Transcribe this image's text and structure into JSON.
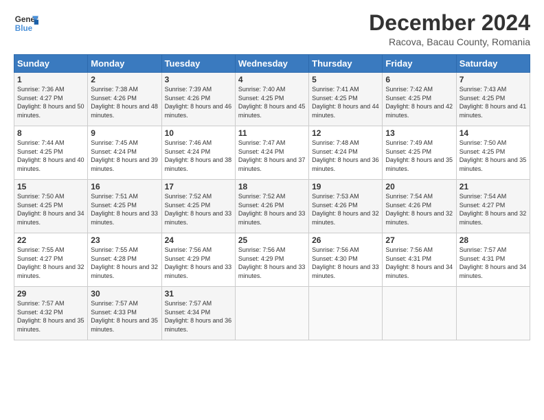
{
  "header": {
    "logo_line1": "General",
    "logo_line2": "Blue",
    "month_title": "December 2024",
    "location": "Racova, Bacau County, Romania"
  },
  "weekdays": [
    "Sunday",
    "Monday",
    "Tuesday",
    "Wednesday",
    "Thursday",
    "Friday",
    "Saturday"
  ],
  "weeks": [
    [
      {
        "day": "1",
        "sunrise": "7:36 AM",
        "sunset": "4:27 PM",
        "daylight": "8 hours and 50 minutes."
      },
      {
        "day": "2",
        "sunrise": "7:38 AM",
        "sunset": "4:26 PM",
        "daylight": "8 hours and 48 minutes."
      },
      {
        "day": "3",
        "sunrise": "7:39 AM",
        "sunset": "4:26 PM",
        "daylight": "8 hours and 46 minutes."
      },
      {
        "day": "4",
        "sunrise": "7:40 AM",
        "sunset": "4:25 PM",
        "daylight": "8 hours and 45 minutes."
      },
      {
        "day": "5",
        "sunrise": "7:41 AM",
        "sunset": "4:25 PM",
        "daylight": "8 hours and 44 minutes."
      },
      {
        "day": "6",
        "sunrise": "7:42 AM",
        "sunset": "4:25 PM",
        "daylight": "8 hours and 42 minutes."
      },
      {
        "day": "7",
        "sunrise": "7:43 AM",
        "sunset": "4:25 PM",
        "daylight": "8 hours and 41 minutes."
      }
    ],
    [
      {
        "day": "8",
        "sunrise": "7:44 AM",
        "sunset": "4:25 PM",
        "daylight": "8 hours and 40 minutes."
      },
      {
        "day": "9",
        "sunrise": "7:45 AM",
        "sunset": "4:24 PM",
        "daylight": "8 hours and 39 minutes."
      },
      {
        "day": "10",
        "sunrise": "7:46 AM",
        "sunset": "4:24 PM",
        "daylight": "8 hours and 38 minutes."
      },
      {
        "day": "11",
        "sunrise": "7:47 AM",
        "sunset": "4:24 PM",
        "daylight": "8 hours and 37 minutes."
      },
      {
        "day": "12",
        "sunrise": "7:48 AM",
        "sunset": "4:24 PM",
        "daylight": "8 hours and 36 minutes."
      },
      {
        "day": "13",
        "sunrise": "7:49 AM",
        "sunset": "4:25 PM",
        "daylight": "8 hours and 35 minutes."
      },
      {
        "day": "14",
        "sunrise": "7:50 AM",
        "sunset": "4:25 PM",
        "daylight": "8 hours and 35 minutes."
      }
    ],
    [
      {
        "day": "15",
        "sunrise": "7:50 AM",
        "sunset": "4:25 PM",
        "daylight": "8 hours and 34 minutes."
      },
      {
        "day": "16",
        "sunrise": "7:51 AM",
        "sunset": "4:25 PM",
        "daylight": "8 hours and 33 minutes."
      },
      {
        "day": "17",
        "sunrise": "7:52 AM",
        "sunset": "4:25 PM",
        "daylight": "8 hours and 33 minutes."
      },
      {
        "day": "18",
        "sunrise": "7:52 AM",
        "sunset": "4:26 PM",
        "daylight": "8 hours and 33 minutes."
      },
      {
        "day": "19",
        "sunrise": "7:53 AM",
        "sunset": "4:26 PM",
        "daylight": "8 hours and 32 minutes."
      },
      {
        "day": "20",
        "sunrise": "7:54 AM",
        "sunset": "4:26 PM",
        "daylight": "8 hours and 32 minutes."
      },
      {
        "day": "21",
        "sunrise": "7:54 AM",
        "sunset": "4:27 PM",
        "daylight": "8 hours and 32 minutes."
      }
    ],
    [
      {
        "day": "22",
        "sunrise": "7:55 AM",
        "sunset": "4:27 PM",
        "daylight": "8 hours and 32 minutes."
      },
      {
        "day": "23",
        "sunrise": "7:55 AM",
        "sunset": "4:28 PM",
        "daylight": "8 hours and 32 minutes."
      },
      {
        "day": "24",
        "sunrise": "7:56 AM",
        "sunset": "4:29 PM",
        "daylight": "8 hours and 33 minutes."
      },
      {
        "day": "25",
        "sunrise": "7:56 AM",
        "sunset": "4:29 PM",
        "daylight": "8 hours and 33 minutes."
      },
      {
        "day": "26",
        "sunrise": "7:56 AM",
        "sunset": "4:30 PM",
        "daylight": "8 hours and 33 minutes."
      },
      {
        "day": "27",
        "sunrise": "7:56 AM",
        "sunset": "4:31 PM",
        "daylight": "8 hours and 34 minutes."
      },
      {
        "day": "28",
        "sunrise": "7:57 AM",
        "sunset": "4:31 PM",
        "daylight": "8 hours and 34 minutes."
      }
    ],
    [
      {
        "day": "29",
        "sunrise": "7:57 AM",
        "sunset": "4:32 PM",
        "daylight": "8 hours and 35 minutes."
      },
      {
        "day": "30",
        "sunrise": "7:57 AM",
        "sunset": "4:33 PM",
        "daylight": "8 hours and 35 minutes."
      },
      {
        "day": "31",
        "sunrise": "7:57 AM",
        "sunset": "4:34 PM",
        "daylight": "8 hours and 36 minutes."
      },
      null,
      null,
      null,
      null
    ]
  ]
}
